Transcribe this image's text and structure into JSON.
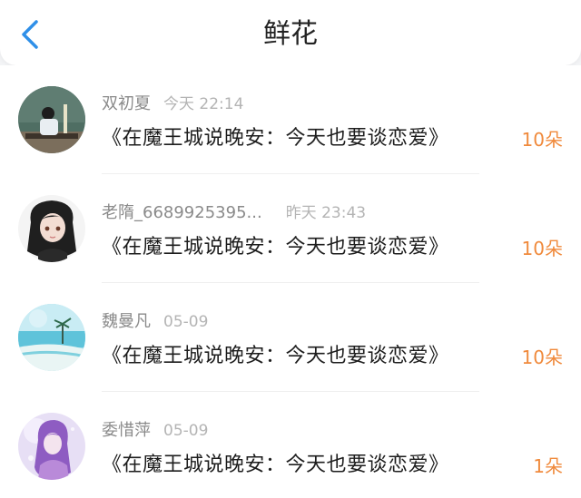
{
  "header": {
    "title": "鲜花"
  },
  "colors": {
    "accent": "#2f8fe8",
    "count": "#f08a3c"
  },
  "items": [
    {
      "name": "双初夏",
      "time": "今天 22:14",
      "book": "《在魔王城说晚安：今天也要谈恋爱》",
      "count": "10朵",
      "avatar_icon": "avatar-classroom"
    },
    {
      "name": "老隋_6689925395...",
      "time": "昨天 23:43",
      "book": "《在魔王城说晚安：今天也要谈恋爱》",
      "count": "10朵",
      "avatar_icon": "avatar-anime-girl"
    },
    {
      "name": "魏曼凡",
      "time": "05-09",
      "book": "《在魔王城说晚安：今天也要谈恋爱》",
      "count": "10朵",
      "avatar_icon": "avatar-beach"
    },
    {
      "name": "委惜萍",
      "time": "05-09",
      "book": "《在魔王城说晚安：今天也要谈恋爱》",
      "count": "1朵",
      "avatar_icon": "avatar-purple-girl"
    }
  ]
}
